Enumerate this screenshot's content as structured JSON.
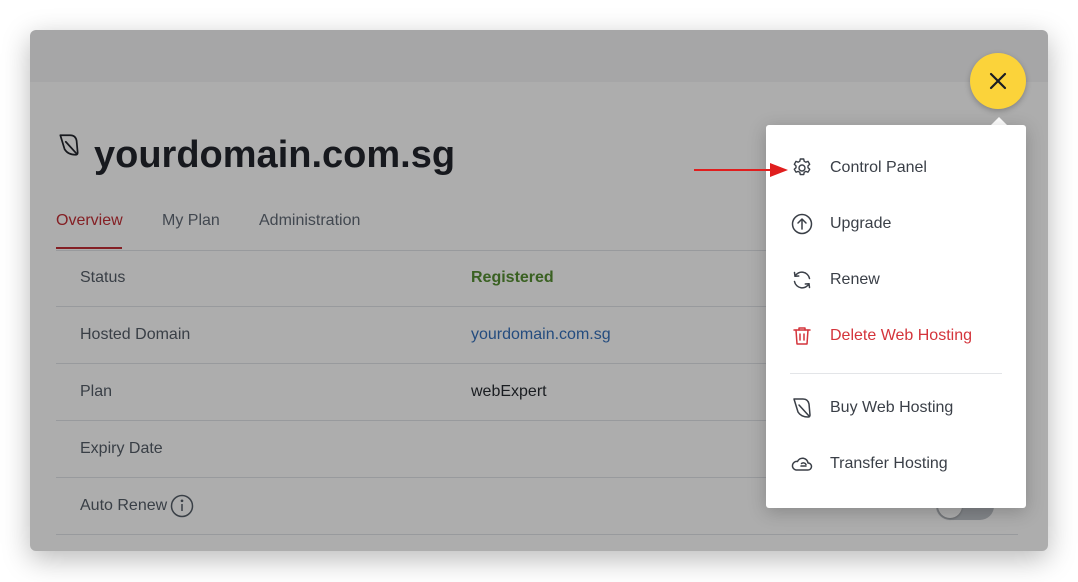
{
  "domain_card": {
    "title": "yourdomain.com.sg",
    "title_icon": "leaf-hosting-icon"
  },
  "tabs": [
    {
      "label": "Overview",
      "active": true
    },
    {
      "label": "My Plan",
      "active": false
    },
    {
      "label": "Administration",
      "active": false
    }
  ],
  "details": {
    "status": {
      "label": "Status",
      "value": "Registered"
    },
    "hosted_domain": {
      "label": "Hosted Domain",
      "value": "yourdomain.com.sg"
    },
    "plan": {
      "label": "Plan",
      "value": "webExpert"
    },
    "expiry_date": {
      "label": "Expiry Date",
      "value": ""
    },
    "auto_renew": {
      "label": "Auto Renew",
      "icon": "info-icon",
      "enabled": false
    }
  },
  "menu": {
    "items": [
      {
        "label": "Control Panel",
        "icon": "gear-icon"
      },
      {
        "label": "Upgrade",
        "icon": "arrow-up-circle-icon"
      },
      {
        "label": "Renew",
        "icon": "refresh-icon"
      },
      {
        "label": "Delete Web Hosting",
        "icon": "trash-icon",
        "danger": true
      },
      {
        "label": "Buy Web Hosting",
        "icon": "leaf-hosting-icon"
      },
      {
        "label": "Transfer Hosting",
        "icon": "cloud-transfer-icon"
      }
    ]
  },
  "close_button": {
    "icon": "close-icon"
  },
  "colors": {
    "accent_red": "#c0262d",
    "status_green": "#4f8a2a",
    "link_blue": "#2d6ab8",
    "danger_red": "#d4343b",
    "fab_yellow": "#fbd33a",
    "pointer_red": "#e01e1e"
  }
}
